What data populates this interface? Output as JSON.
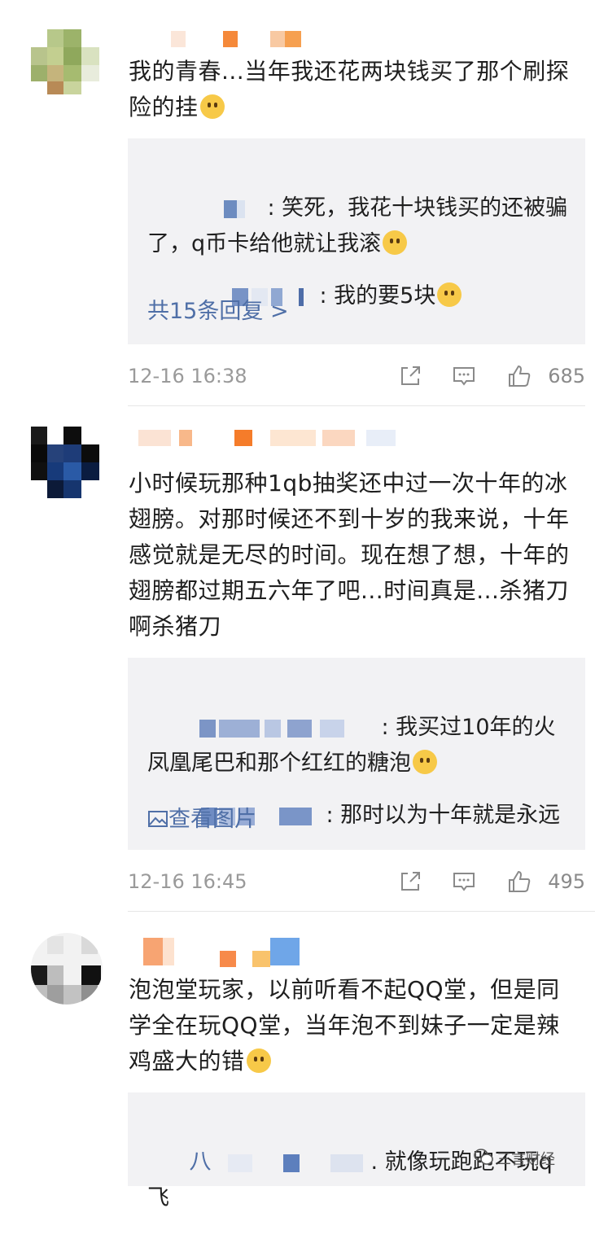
{
  "comments": [
    {
      "text": "我的青春...当年我还花两块钱买了那个刷探险的挂",
      "emoji": "crying-face",
      "replies": [
        {
          "text": ": 笑死，我花十块钱买的还被骗了，q币卡给他就让我滚",
          "emoji": "pleading-face"
        },
        {
          "text": ": 我的要5块",
          "emoji": "pleading-face"
        }
      ],
      "more_replies": "共15条回复 >",
      "time": "12-16 16:38",
      "likes": "685"
    },
    {
      "text": "小时候玩那种1qb抽奖还中过一次十年的冰翅膀。对那时候还不到十岁的我来说，十年感觉就是无尽的时间。现在想了想，十年的翅膀都过期五六年了吧...时间真是...杀猪刀啊杀猪刀",
      "replies": [
        {
          "text": ": 我买过10年的火凤凰尾巴和那个红红的糖泡",
          "emoji": "pleading-face"
        },
        {
          "text": ": 那时以为十年就是永远",
          "emoji": ""
        }
      ],
      "view_image": "查看图片",
      "time": "12-16 16:45",
      "likes": "495"
    },
    {
      "text": "泡泡堂玩家，以前听看不起QQ堂，但是同学全在玩QQ堂，当年泡不到妹子一定是辣鸡盛大的错",
      "emoji": "grimacing-face",
      "replies": [
        {
          "prefix": "八",
          "text": ". 就像玩跑跑不玩q飞",
          "emoji": ""
        }
      ]
    }
  ],
  "watermark": "三言财经",
  "colors": {
    "link_blue": "#4f6fa7",
    "reply_bg": "#f2f2f4",
    "meta_gray": "#9a9a9a"
  }
}
